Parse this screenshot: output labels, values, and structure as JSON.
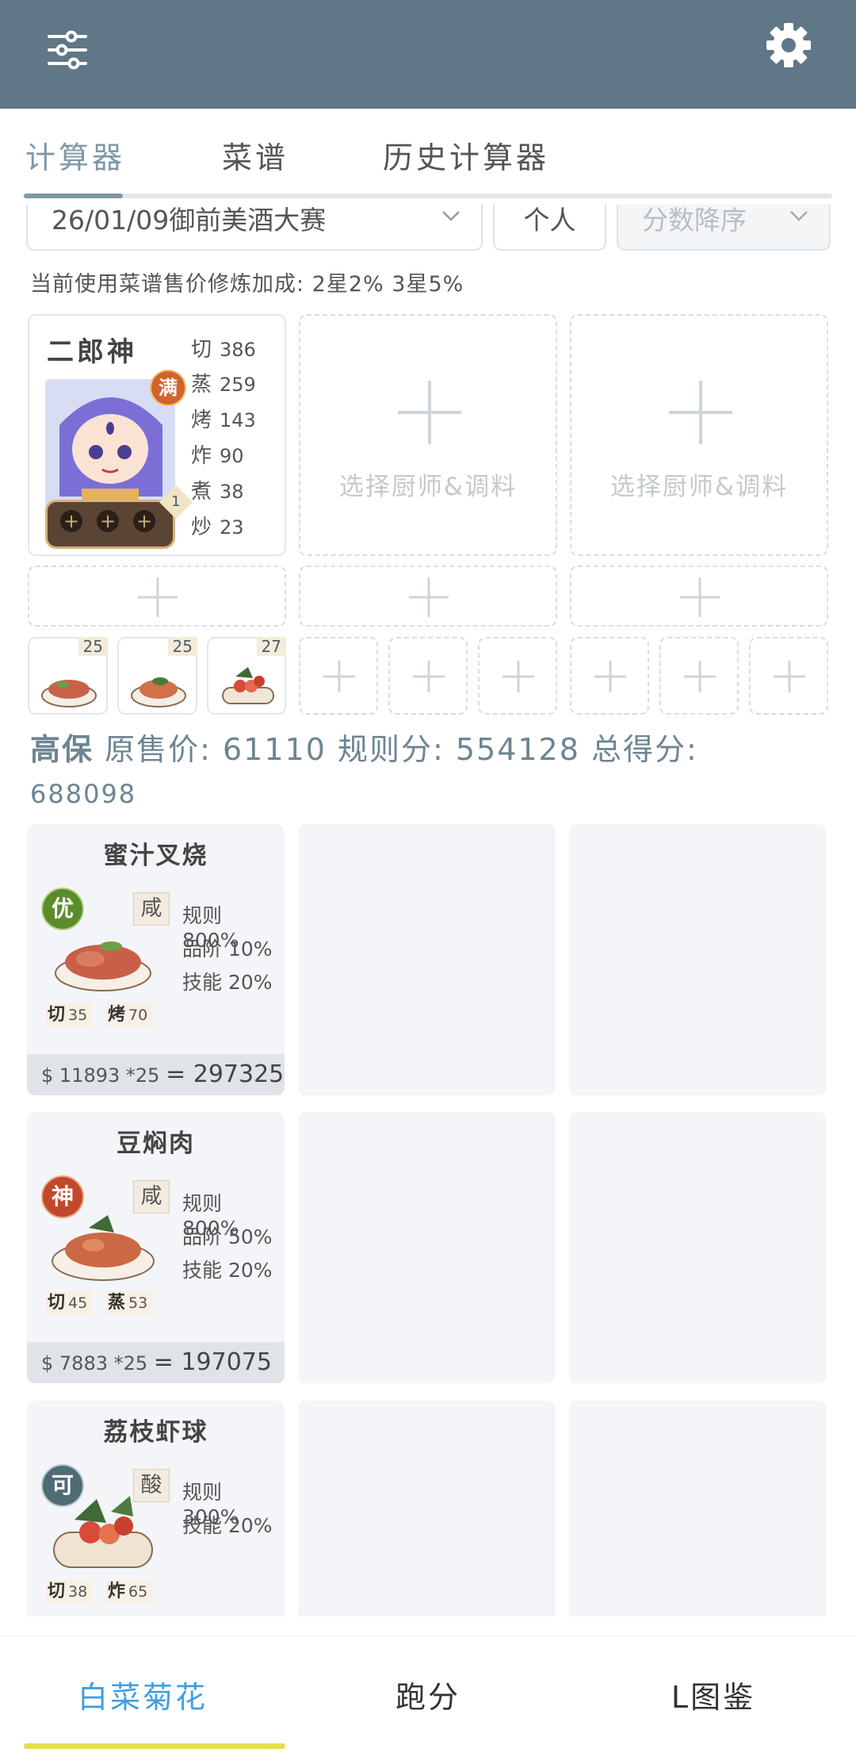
{
  "tabs": [
    "计算器",
    "菜谱",
    "历史计算器"
  ],
  "filters": {
    "event": "26/01/09御前美酒大赛",
    "mode": "个人",
    "sort": "分数降序"
  },
  "bonus_text": "当前使用菜谱售价修炼加成: 2星2% 3星5%",
  "chef": {
    "name": "二郎神",
    "full_badge": "满",
    "level_badge": "1",
    "stats": [
      {
        "label": "切",
        "value": "386"
      },
      {
        "label": "蒸",
        "value": "259"
      },
      {
        "label": "烤",
        "value": "143"
      },
      {
        "label": "炸",
        "value": "90"
      },
      {
        "label": "煮",
        "value": "38"
      },
      {
        "label": "炒",
        "value": "23"
      }
    ]
  },
  "empty_slot_label": "选择厨师&调料",
  "recipe_slot_counts": [
    "25",
    "25",
    "27"
  ],
  "summary": {
    "title": "高保",
    "line1": "原售价: 61110 规则分: 554128 总得分:",
    "line2": "688098"
  },
  "dishes": [
    {
      "name": "蜜汁叉烧",
      "rank": "优",
      "rank_color": "#5b8c2a",
      "flavor": "咸",
      "multipliers": [
        "规则 800%",
        "品阶 10%",
        "技能 20%"
      ],
      "skills": [
        {
          "label": "切",
          "value": "35"
        },
        {
          "label": "烤",
          "value": "70"
        }
      ],
      "price": "$ 11893 *25",
      "total": "= 297325"
    },
    {
      "name": "豆焖肉",
      "rank": "神",
      "rank_color": "#c0492b",
      "flavor": "咸",
      "multipliers": [
        "规则 800%",
        "品阶 50%",
        "技能 20%"
      ],
      "skills": [
        {
          "label": "切",
          "value": "45"
        },
        {
          "label": "蒸",
          "value": "53"
        }
      ],
      "price": "$ 7883 *25",
      "total": "= 197075"
    },
    {
      "name": "荔枝虾球",
      "rank": "可",
      "rank_color": "#4f6b74",
      "flavor": "酸",
      "multipliers": [
        "规则 300%",
        "技能 20%"
      ],
      "skills": [
        {
          "label": "切",
          "value": "38"
        },
        {
          "label": "炸",
          "value": "65"
        }
      ]
    }
  ],
  "bottom_nav": [
    "白菜菊花",
    "跑分",
    "L图鉴"
  ],
  "colors": {
    "header": "#5f7786",
    "accent": "#7e98a8",
    "nav_active": "#3f9fe0",
    "nav_indicator": "#e4dd4f",
    "card_bg": "#f3f5f8"
  },
  "icons": [
    "sliders-icon",
    "gear-icon",
    "chevron-down-icon",
    "plus-icon"
  ]
}
